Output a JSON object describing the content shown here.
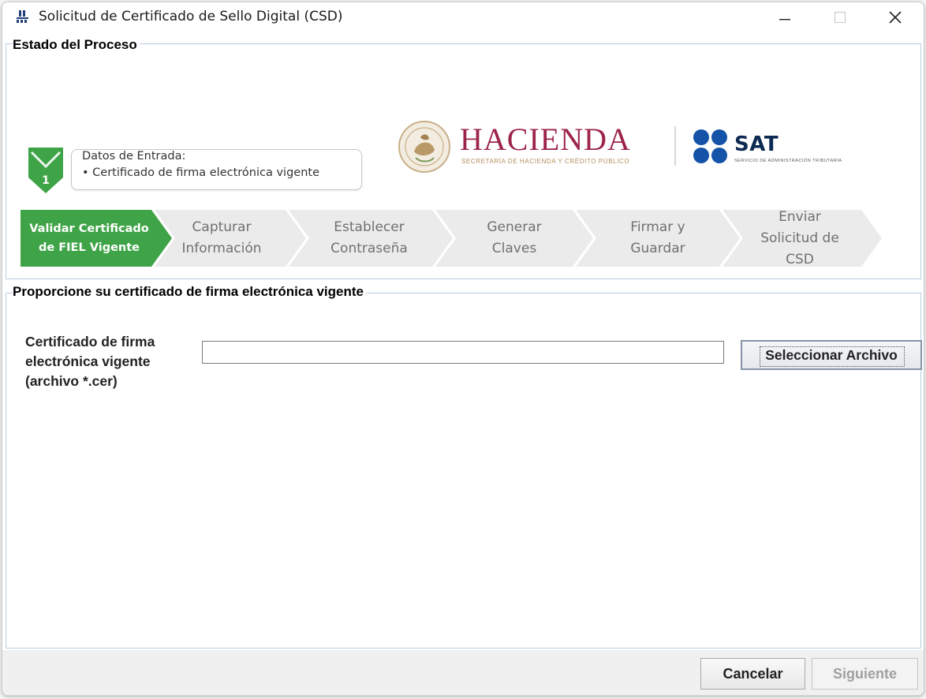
{
  "window": {
    "title": "Solicitud de Certificado de Sello Digital (CSD)"
  },
  "process_group": {
    "title": "Estado del Proceso",
    "logo_hacienda": "HACIENDA",
    "logo_hacienda_sub": "SECRETARÍA DE HACIENDA Y CRÉDITO PÚBLICO",
    "logo_sat": "SAT",
    "logo_sat_sub": "SERVICIO DE ADMINISTRACIÓN TRIBUTARIA",
    "step_number": "1",
    "input_box": {
      "title": "Datos de Entrada:",
      "items": [
        "•  Certificado de firma electrónica vigente"
      ]
    },
    "steps": [
      {
        "line1": "Validar Certificado",
        "line2": "de FIEL Vigente",
        "line3": "",
        "active": true
      },
      {
        "line1": "Capturar",
        "line2": "Información",
        "line3": "",
        "active": false
      },
      {
        "line1": "Establecer",
        "line2": "Contraseña",
        "line3": "",
        "active": false
      },
      {
        "line1": "Generar",
        "line2": "Claves",
        "line3": "",
        "active": false
      },
      {
        "line1": "Firmar y",
        "line2": "Guardar",
        "line3": "",
        "active": false
      },
      {
        "line1": "Enviar",
        "line2": "Solicitud de",
        "line3": "CSD",
        "active": false
      }
    ]
  },
  "cert_group": {
    "title": "Proporcione su certificado de firma electrónica vigente",
    "field_label_line1": "Certificado de firma",
    "field_label_line2": "electrónica vigente",
    "field_label_line3": "(archivo *.cer)",
    "file_value": "",
    "select_button": "Seleccionar Archivo"
  },
  "footer": {
    "cancel": "Cancelar",
    "next": "Siguiente"
  },
  "colors": {
    "active_step": "#3fa447",
    "inactive_step": "#ebebeb",
    "hacienda": "#9d2449",
    "sat_blue": "#1553a8"
  }
}
